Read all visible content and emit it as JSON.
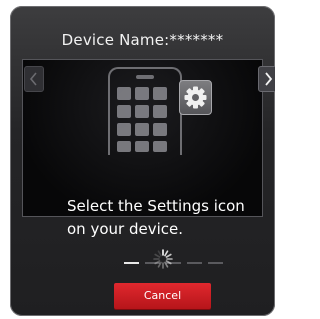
{
  "dialog": {
    "title": "Device Name:*******",
    "instruction": "Select the Settings icon on your device.",
    "cancel_label": "Cancel"
  },
  "carousel": {
    "page_count": 5,
    "active_page": 1,
    "prev_icon": "chevron-left-icon",
    "next_icon": "chevron-right-icon",
    "illustration_icons": [
      "phone-icon",
      "gear-icon"
    ]
  },
  "colors": {
    "panel_bg": "#252527",
    "cancel_button": "#d1181e",
    "text": "#ffffff"
  }
}
